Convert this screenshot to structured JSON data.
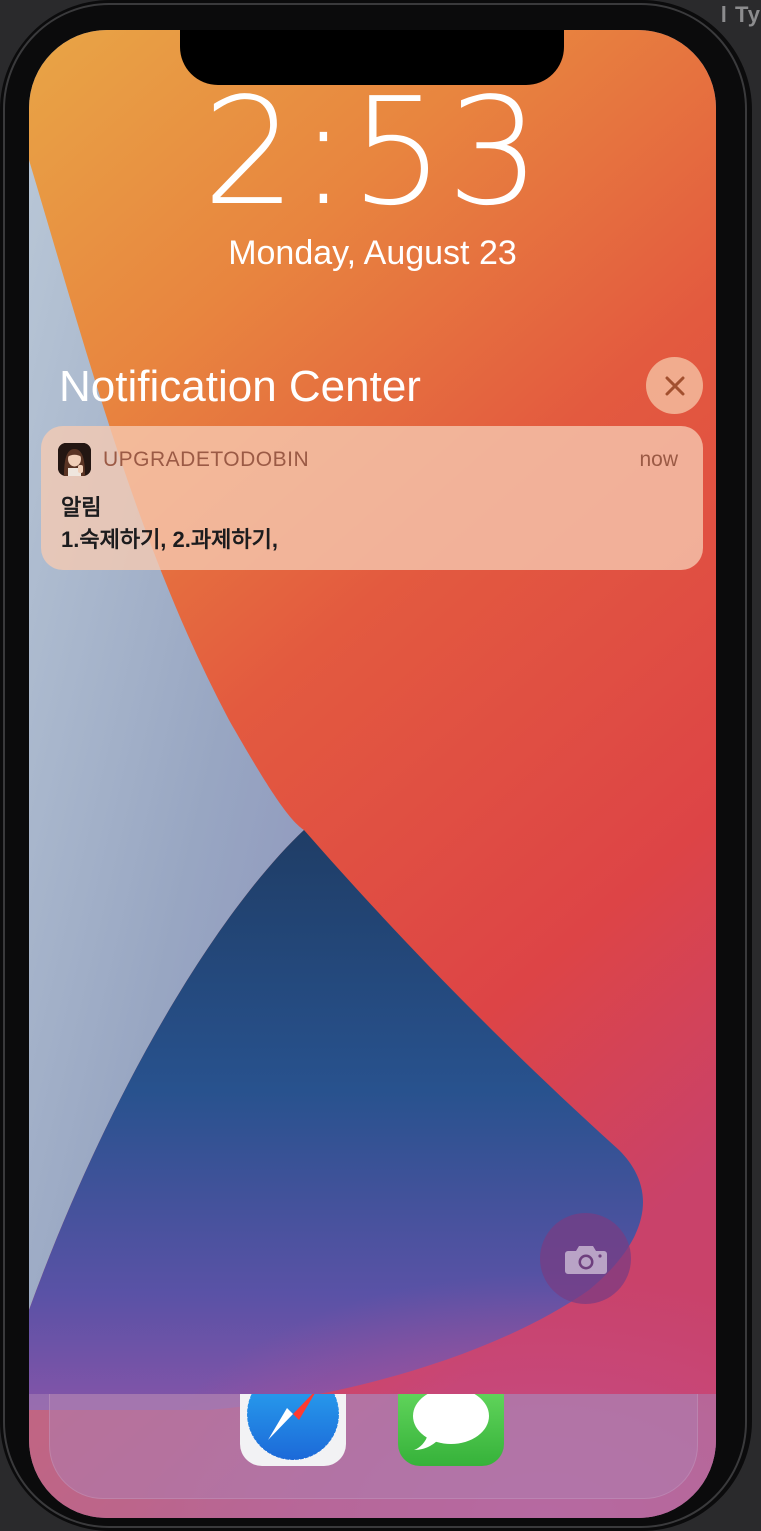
{
  "corner_text": "l Ty",
  "lock_screen": {
    "time": "2:53",
    "date": "Monday, August 23"
  },
  "notification_center": {
    "title": "Notification Center",
    "close_icon": "close-x-icon"
  },
  "notification": {
    "app_name": "UPGRADETODOBIN",
    "time": "now",
    "title": "알림",
    "body": "1.숙제하기, 2.과제하기,"
  },
  "quick_actions": {
    "camera_icon": "camera-icon"
  },
  "dock": {
    "apps": [
      "Safari",
      "Messages"
    ]
  },
  "colors": {
    "wallpaper_orange": "#e8963f",
    "wallpaper_red": "#e04a44",
    "wallpaper_blue": "#2c5894",
    "notification_accent": "#9b5a45"
  }
}
